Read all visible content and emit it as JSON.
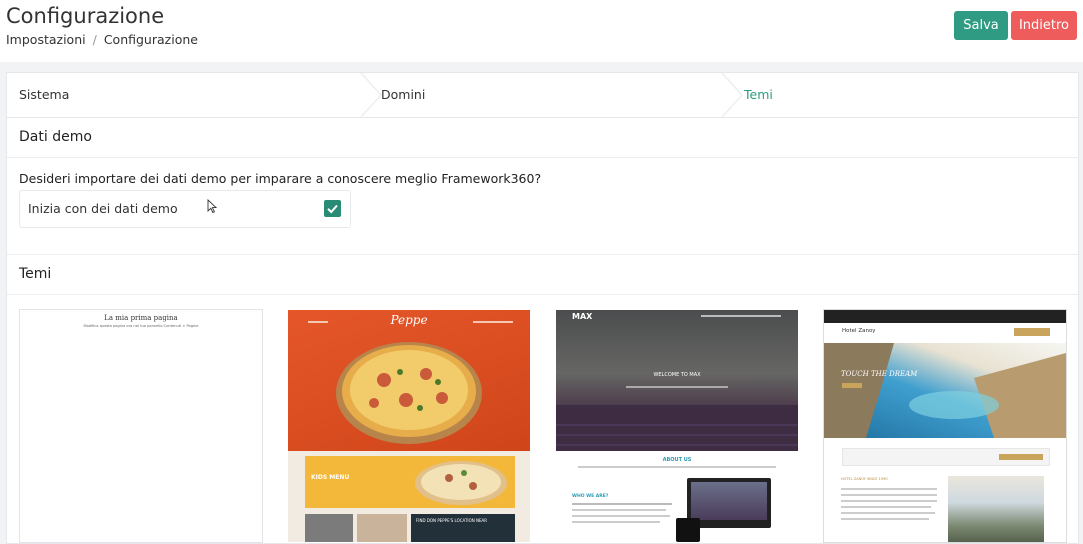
{
  "header": {
    "title": "Configurazione",
    "breadcrumb": [
      "Impostazioni",
      "Configurazione"
    ],
    "save_label": "Salva",
    "back_label": "Indietro"
  },
  "steps": [
    {
      "label": "Sistema"
    },
    {
      "label": "Domini"
    },
    {
      "label": "Temi"
    }
  ],
  "demo": {
    "section_title": "Dati demo",
    "question": "Desideri importare dei dati demo per imparare a conoscere meglio Framework360?",
    "checkbox_label": "Inizia con dei dati demo",
    "checked": true
  },
  "themes": {
    "section_title": "Temi",
    "items": [
      {
        "heading": "La mia prima pagina",
        "subtext": "Modifica questa pagina ora nel tuo pannello Contenuti > Pagine"
      },
      {
        "logo": "Peppe",
        "kids_menu": "KIDS MENU",
        "location": "FIND DON PEPPE'S LOCATION NEAR"
      },
      {
        "logo": "MAX",
        "hero": "WELCOME TO MAX",
        "about": "ABOUT US",
        "who": "WHO WE ARE?"
      },
      {
        "brand": "Hotel Zanoy",
        "hero": "TOUCH THE DREAM",
        "since": "HOTEL ZANOY SINCE 1990"
      }
    ]
  },
  "colors": {
    "accent": "#2e9b82",
    "danger": "#ee5c5c"
  }
}
